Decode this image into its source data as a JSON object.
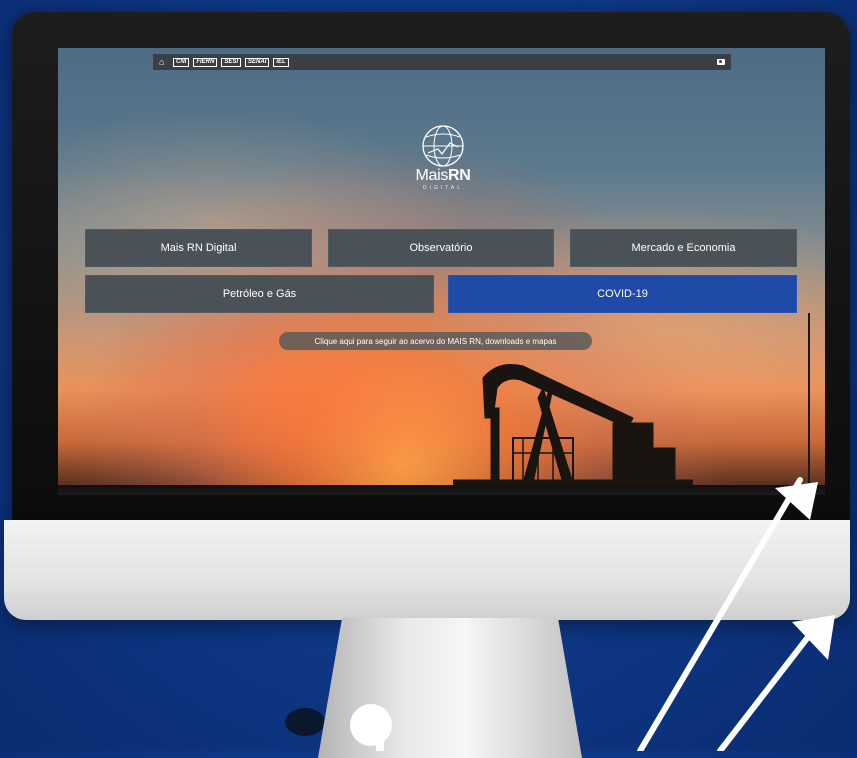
{
  "topbar": {
    "home_icon": "home-icon",
    "brands": [
      "CNI",
      "FIERN",
      "SESI",
      "SENAI",
      "IEL"
    ]
  },
  "logo": {
    "name_light": "Mais",
    "name_bold": "RN",
    "subtitle": "DIGITAL"
  },
  "nav": {
    "row1": [
      "Mais RN Digital",
      "Observatório",
      "Mercado e Economia"
    ],
    "row2": [
      "Petróleo e Gás",
      "COVID-19"
    ]
  },
  "cta": "Clique aqui para seguir ao acervo do MAIS RN, downloads e mapas",
  "colors": {
    "background": "#0f3a8a",
    "button": "#4a5258",
    "covid_button": "#1f4aa8",
    "topbar": "#3b3f44"
  }
}
